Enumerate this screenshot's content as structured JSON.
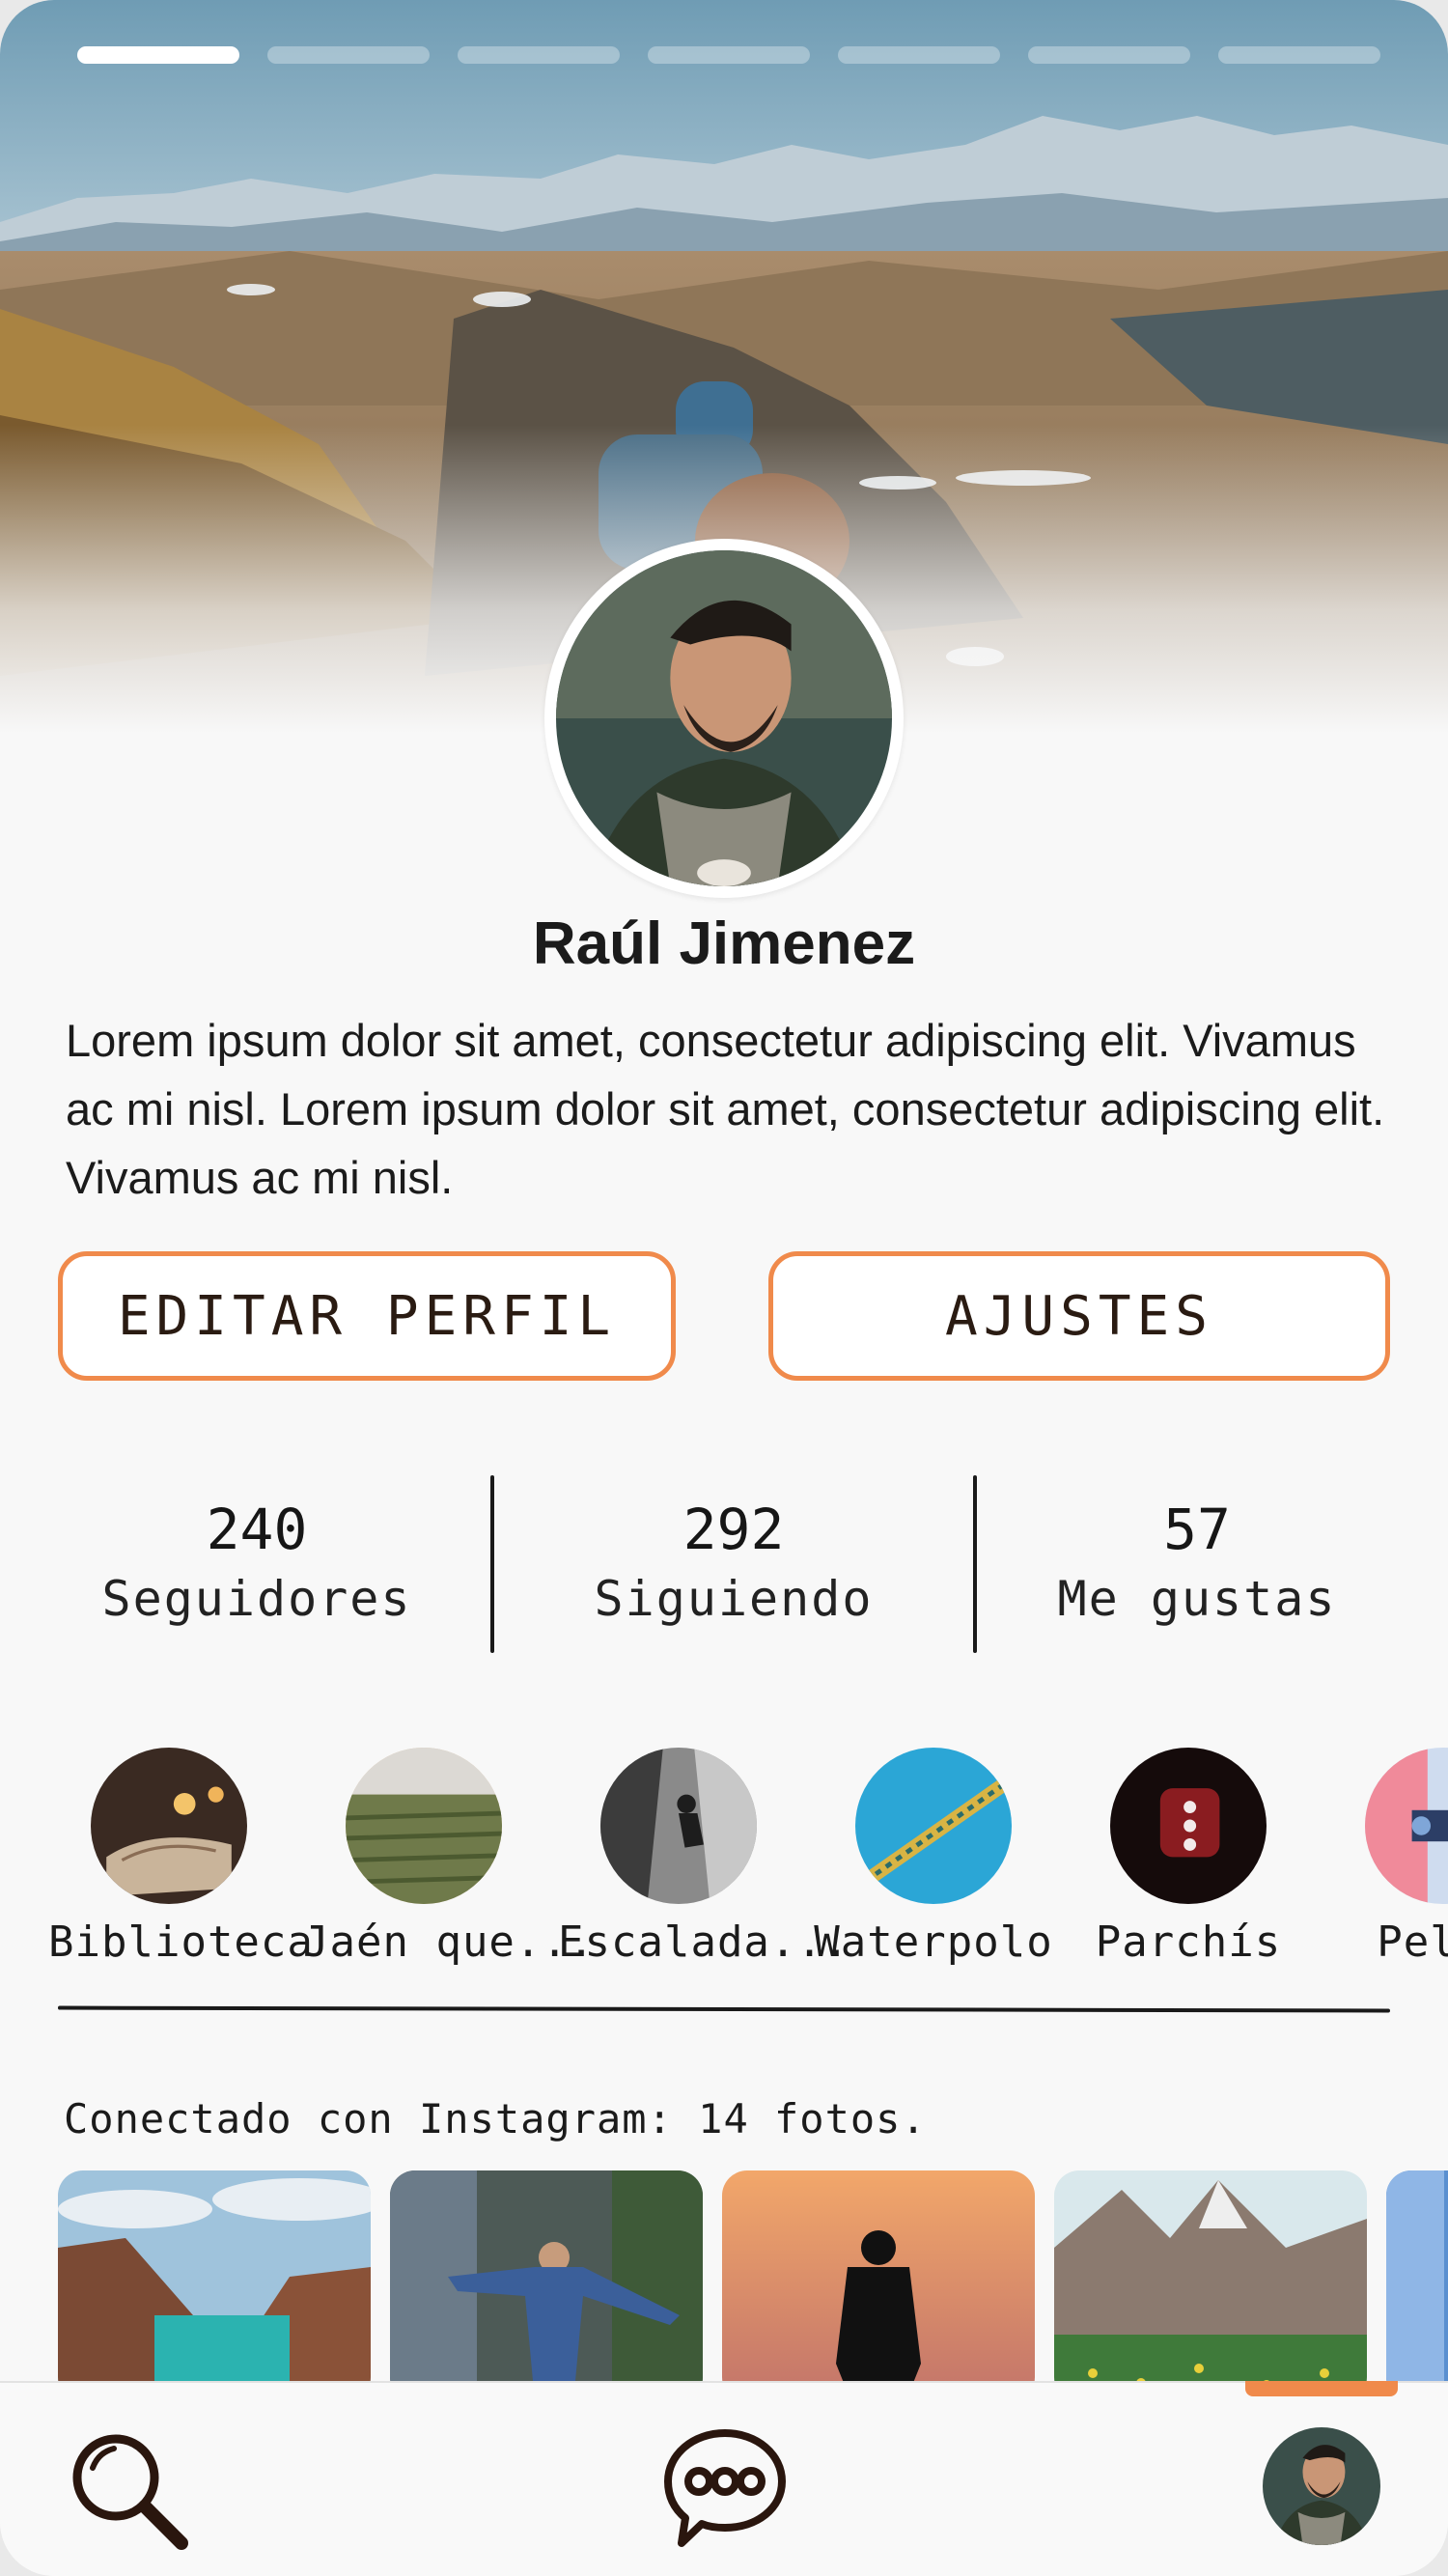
{
  "profile": {
    "name": "Raúl Jimenez",
    "bio": "Lorem ipsum dolor sit amet, consectetur adipiscing elit. Vivamus ac mi nisl. Lorem ipsum dolor sit amet, consectetur adipiscing elit. Vivamus ac mi nisl."
  },
  "story_progress": {
    "segments": 7,
    "active_index": 0
  },
  "buttons": {
    "edit_profile": "EDITAR PERFIL",
    "settings": "AJUSTES"
  },
  "stats": [
    {
      "value": "240",
      "label": "Seguidores"
    },
    {
      "value": "292",
      "label": "Siguiendo"
    },
    {
      "value": "57",
      "label": "Me gustas"
    }
  ],
  "highlights": [
    {
      "label": "Biblioteca",
      "icon": "books-candle-photo"
    },
    {
      "label": "Jaén que...",
      "icon": "olive-grove-photo"
    },
    {
      "label": "Escalada...",
      "icon": "climbing-photo"
    },
    {
      "label": "Waterpolo",
      "icon": "pool-lane-photo"
    },
    {
      "label": "Parchís",
      "icon": "dice-photo"
    },
    {
      "label": "Pelíc",
      "icon": "film-camera-photo"
    }
  ],
  "instagram": {
    "text": "Conectado con Instagram: 14 fotos."
  },
  "nav": {
    "icons": [
      "search-icon",
      "chat-icon",
      "profile-avatar"
    ],
    "accent": "#f08a4b"
  },
  "colors": {
    "accent": "#f08a4b",
    "text": "#1b1b1b",
    "background": "#f8f8f8"
  }
}
